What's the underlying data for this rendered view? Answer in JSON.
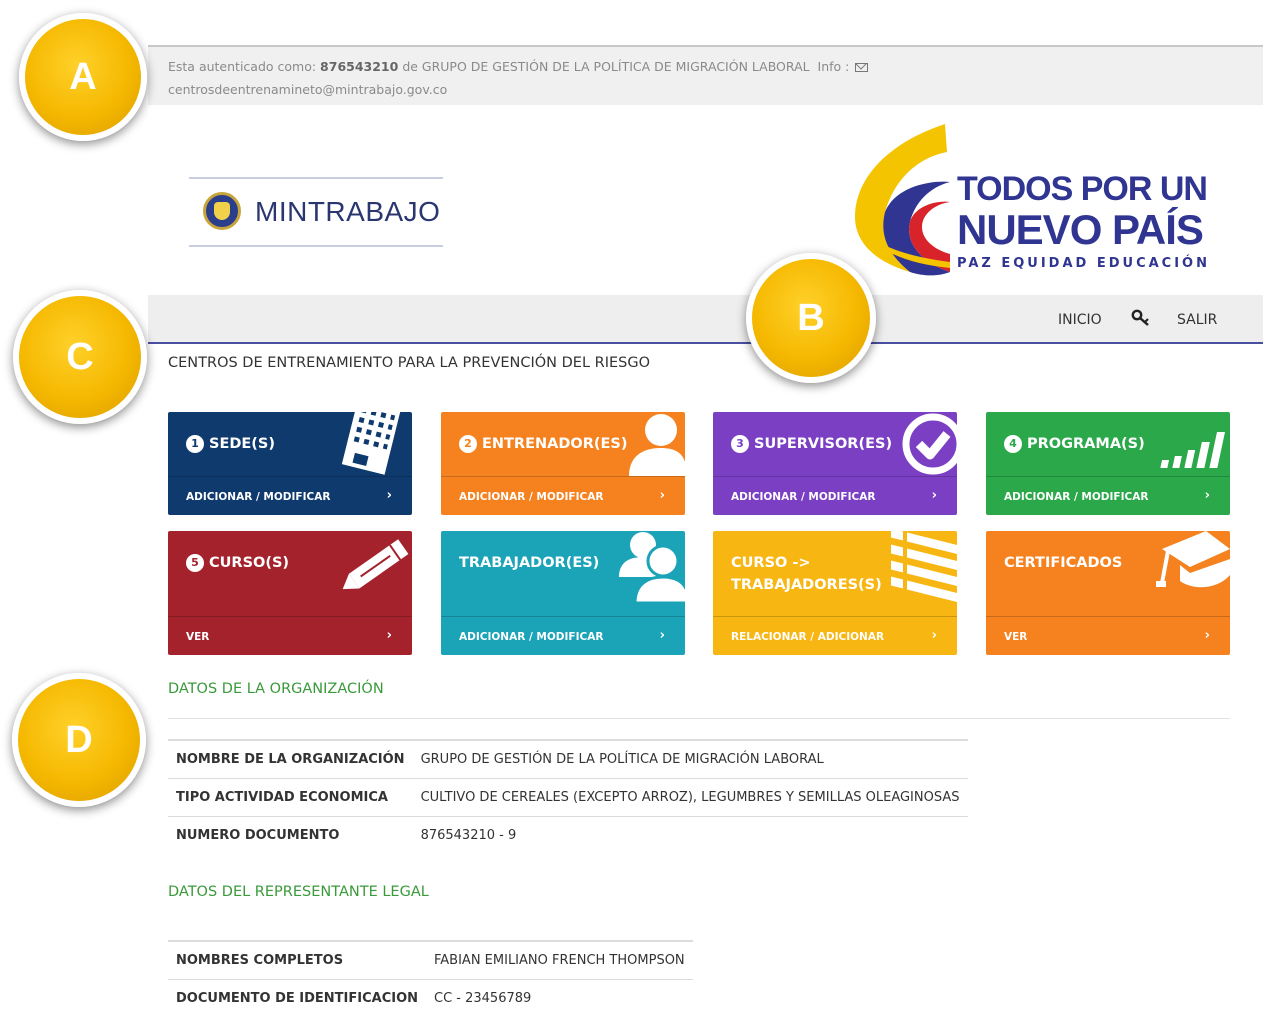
{
  "auth": {
    "prefix": "Esta autenticado como:",
    "user_id": "876543210",
    "middle": "de GRUPO DE GESTIÓN DE LA POLÍTICA DE MIGRACIÓN LABORAL",
    "info_label": "Info :",
    "email": "centrosdeentrenamineto@mintrabajo.gov.co"
  },
  "logos": {
    "ministry": "MINTRABAJO",
    "slogan_line1": "TODOS POR UN",
    "slogan_line2": "NUEVO PAÍS",
    "slogan_line3": "PAZ EQUIDAD EDUCACIÓN"
  },
  "nav": {
    "home": "INICIO",
    "logout": "SALIR"
  },
  "page_title": "CENTROS DE ENTRENAMIENTO PARA LA PREVENCIÓN DEL RIESGO",
  "tiles": [
    {
      "num": "1",
      "title": "SEDE(S)",
      "action": "ADICIONAR / MODIFICAR",
      "color": "#0f3a6e",
      "icon": "building-icon"
    },
    {
      "num": "2",
      "title": "ENTRENADOR(ES)",
      "action": "ADICIONAR / MODIFICAR",
      "color": "#f5821f",
      "icon": "user-icon"
    },
    {
      "num": "3",
      "title": "SUPERVISOR(ES)",
      "action": "ADICIONAR / MODIFICAR",
      "color": "#7b3fc4",
      "icon": "check-circle-icon"
    },
    {
      "num": "4",
      "title": "PROGRAMA(S)",
      "action": "ADICIONAR / MODIFICAR",
      "color": "#2aa84a",
      "icon": "signal-bars-icon"
    },
    {
      "num": "5",
      "title": "CURSO(S)",
      "action": "VER",
      "color": "#a3222b",
      "icon": "pencil-icon"
    },
    {
      "num": "",
      "title": "TRABAJADOR(ES)",
      "action": "ADICIONAR / MODIFICAR",
      "color": "#1ba3b8",
      "icon": "users-icon"
    },
    {
      "num": "",
      "title": "CURSO -> TRABAJADORES(S)",
      "action": "RELACIONAR / ADICIONAR",
      "color": "#f7b612",
      "icon": "list-icon"
    },
    {
      "num": "",
      "title": "CERTIFICADOS",
      "action": "VER",
      "color": "#f5821f",
      "icon": "graduation-cap-icon"
    }
  ],
  "org": {
    "section_title": "DATOS DE LA ORGANIZACIÓN",
    "rows": [
      {
        "label": "NOMBRE DE LA ORGANIZACIÓN",
        "value": "GRUPO DE GESTIÓN DE LA POLÍTICA DE MIGRACIÓN LABORAL"
      },
      {
        "label": "TIPO ACTIVIDAD ECONOMICA",
        "value": "CULTIVO DE CEREALES (EXCEPTO ARROZ), LEGUMBRES Y SEMILLAS OLEAGINOSAS"
      },
      {
        "label": "NUMERO DOCUMENTO",
        "value": "876543210 - 9"
      }
    ]
  },
  "rep": {
    "section_title": "DATOS DEL REPRESENTANTE LEGAL",
    "rows": [
      {
        "label": "NOMBRES COMPLETOS",
        "value": "FABIAN EMILIANO FRENCH THOMPSON"
      },
      {
        "label": "DOCUMENTO DE IDENTIFICACION",
        "value": "CC - 23456789"
      }
    ]
  },
  "callouts": [
    "A",
    "B",
    "C",
    "D"
  ]
}
